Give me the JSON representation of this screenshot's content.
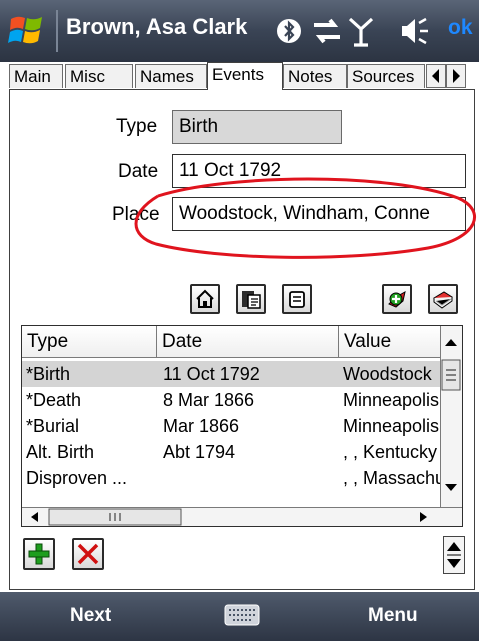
{
  "titlebar": {
    "title": "Brown, Asa Clark",
    "ok_label": "ok",
    "icons": [
      "windows-start-icon",
      "bluetooth-icon",
      "connectivity-icon",
      "signal-icon",
      "speaker-icon"
    ]
  },
  "tabs": [
    {
      "label": "Main"
    },
    {
      "label": "Misc"
    },
    {
      "label": "Names"
    },
    {
      "label": "Events",
      "active": true
    },
    {
      "label": "Notes"
    },
    {
      "label": "Sources"
    }
  ],
  "form": {
    "type_label": "Type",
    "type_value": "Birth",
    "date_label": "Date",
    "date_value": "11 Oct 1792",
    "place_label": "Place",
    "place_value": "Woodstock, Windham, Conne"
  },
  "toolbar_icons": [
    "home-icon",
    "family-icon",
    "copy-icon",
    "add-source-icon",
    "book-icon"
  ],
  "events_table": {
    "headers": [
      "Type",
      "Date",
      "Value"
    ],
    "rows": [
      {
        "type": "*Birth",
        "date": "11 Oct 1792",
        "value": "Woodstock",
        "selected": true
      },
      {
        "type": "*Death",
        "date": "8 Mar 1866",
        "value": "Minneapolis"
      },
      {
        "type": "*Burial",
        "date": "Mar 1866",
        "value": "Minneapolis"
      },
      {
        "type": "Alt. Birth",
        "date": "Abt 1794",
        "value": ", , Kentucky"
      },
      {
        "type": "Disproven ...",
        "date": "",
        "value": ", , Massachusetts"
      }
    ]
  },
  "bottombar": {
    "left_softkey": "Next",
    "right_softkey": "Menu"
  },
  "colors": {
    "titlebar": "#3a4455",
    "ok": "#1e88ff",
    "selected_row": "#d4d4d4",
    "annotation": "#e0141e",
    "add_green": "#1e9e1e",
    "delete_red": "#d01010"
  }
}
